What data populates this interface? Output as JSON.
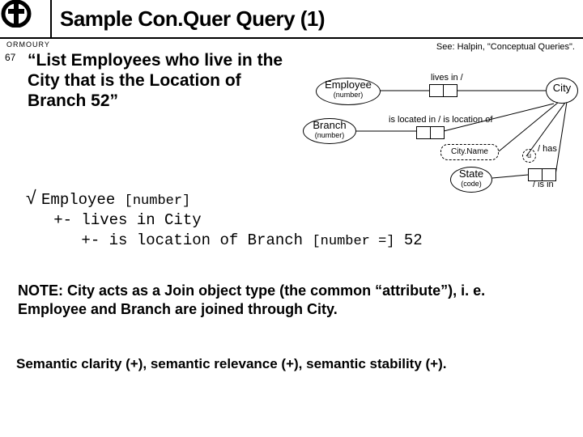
{
  "header": {
    "title": "Sample Con.Quer Query (1)",
    "subtitle": "ORMOURY",
    "page": "67",
    "see": "See:  Halpin, \"Conceptual Queries\"."
  },
  "quote": "“List Employees who live in the City that is the Location of Branch 52”",
  "entities": {
    "employee": {
      "name": "Employee",
      "ref": "(number)"
    },
    "branch": {
      "name": "Branch",
      "ref": "(number)"
    },
    "city": {
      "name": "City"
    },
    "state": {
      "name": "State",
      "ref": "(code)"
    },
    "cityname": "City.Name",
    "u": "u"
  },
  "roles": {
    "livesIn": "lives in /",
    "located": "is located in / is location of",
    "has": "/ has",
    "isIn": "/ is in"
  },
  "query": {
    "l1a": "Employee ",
    "l1b": "[number]",
    "l2": "   +- lives in City",
    "l3a": "      +- is location of Branch ",
    "l3b": "[number =]",
    "l3c": " 52"
  },
  "note": "NOTE: City acts as a Join object type (the common “attribute”), i. e. Employee and Branch are joined through City.",
  "footer": "Semantic clarity (+),   semantic relevance (+),   semantic stability (+)."
}
